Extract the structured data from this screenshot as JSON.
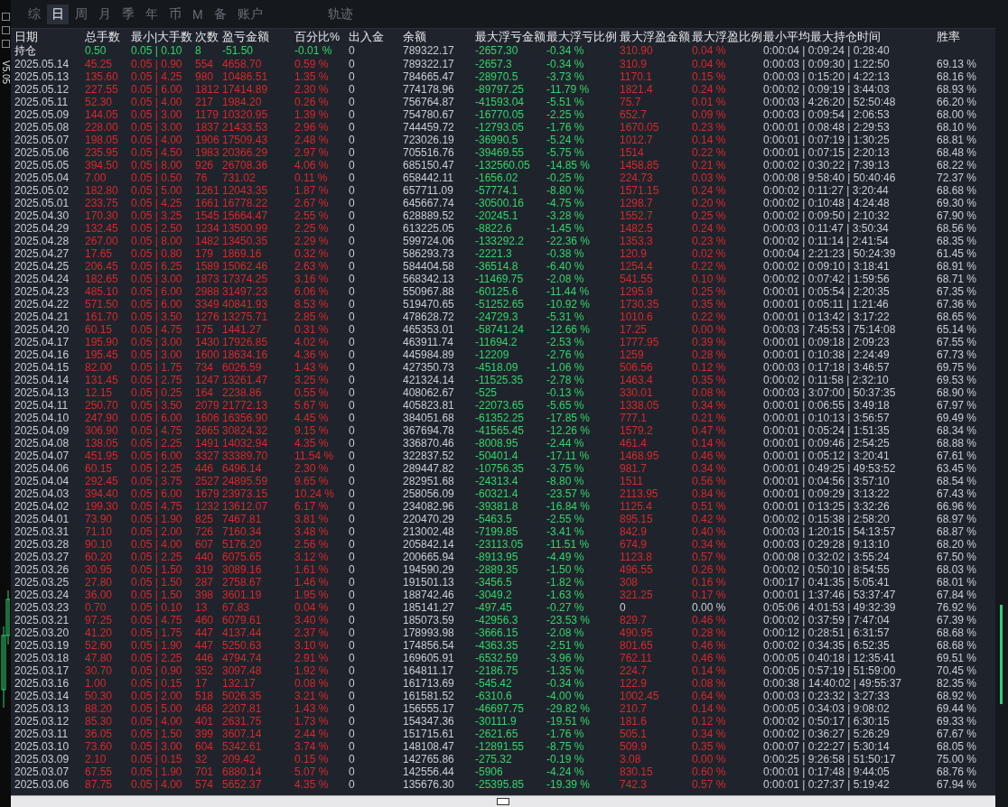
{
  "sidebar": {
    "version": "V5.05"
  },
  "tabs": [
    {
      "label": "综",
      "selected": false
    },
    {
      "label": "日",
      "selected": true
    },
    {
      "label": "周",
      "selected": false
    },
    {
      "label": "月",
      "selected": false
    },
    {
      "label": "季",
      "selected": false
    },
    {
      "label": "年",
      "selected": false
    },
    {
      "label": "币",
      "selected": false
    },
    {
      "label": "M",
      "selected": false
    },
    {
      "label": "备",
      "selected": false
    },
    {
      "label": "账户",
      "selected": false
    }
  ],
  "track_button": {
    "label": "轨迹"
  },
  "table": {
    "columns": [
      "日期",
      "总手数",
      "最小|大手数",
      "次数",
      "盈亏金额",
      "百分比%",
      "出入金",
      "余额",
      "最大浮亏金额",
      "最大浮亏比例",
      "最大浮盈金额",
      "最大浮盈比例",
      "最小平均最大持仓时间",
      "胜率"
    ],
    "holding": {
      "loss": true,
      "zero_peak": false,
      "cells": [
        "持仓",
        "0.50",
        "0.05 | 0.10",
        "8",
        "-51.50",
        "-0.01 %",
        "0",
        "789322.17",
        "-2657.30",
        "-0.34 %",
        "310.90",
        "0.04 %",
        "0:00:04 | 0:09:24 | 0:28:40"
      ]
    },
    "rows": [
      {
        "loss": false,
        "zero_peak": false,
        "cells": [
          "2025.05.14",
          "45.25",
          "0.05 | 0.90",
          "554",
          "4658.70",
          "0.59 %",
          "0",
          "789322.17",
          "-2657.3",
          "-0.34 %",
          "310.9",
          "0.04 %",
          "0:00:03 | 0:09:30 | 1:22:50",
          "69.13 %"
        ]
      },
      {
        "loss": false,
        "zero_peak": false,
        "cells": [
          "2025.05.13",
          "135.60",
          "0.05 | 4.25",
          "980",
          "10486.51",
          "1.35 %",
          "0",
          "784665.47",
          "-28970.5",
          "-3.73 %",
          "1170.1",
          "0.15 %",
          "0:00:03 | 0:15:20 | 4:22:13",
          "68.16 %"
        ]
      },
      {
        "loss": false,
        "zero_peak": false,
        "cells": [
          "2025.05.12",
          "227.55",
          "0.05 | 6.00",
          "1812",
          "17414.89",
          "2.30 %",
          "0",
          "774178.96",
          "-89797.25",
          "-11.79 %",
          "1821.4",
          "0.24 %",
          "0:00:02 | 0:09:19 | 3:44:03",
          "68.93 %"
        ]
      },
      {
        "loss": false,
        "zero_peak": false,
        "cells": [
          "2025.05.11",
          "52.30",
          "0.05 | 4.00",
          "217",
          "1984.20",
          "0.26 %",
          "0",
          "756764.87",
          "-41593.04",
          "-5.51 %",
          "75.7",
          "0.01 %",
          "0:00:03 | 4:26:20 | 52:50:48",
          "66.20 %"
        ]
      },
      {
        "loss": false,
        "zero_peak": false,
        "cells": [
          "2025.05.09",
          "144.05",
          "0.05 | 3.00",
          "1179",
          "10320.95",
          "1.39 %",
          "0",
          "754780.67",
          "-16770.05",
          "-2.25 %",
          "652.7",
          "0.09 %",
          "0:00:03 | 0:09:54 | 2:06:53",
          "68.00 %"
        ]
      },
      {
        "loss": false,
        "zero_peak": false,
        "cells": [
          "2025.05.08",
          "228.00",
          "0.05 | 3.00",
          "1837",
          "21433.53",
          "2.96 %",
          "0",
          "744459.72",
          "-12793.05",
          "-1.76 %",
          "1670.05",
          "0.23 %",
          "0:00:01 | 0:08:48 | 2:29:53",
          "68.10 %"
        ]
      },
      {
        "loss": false,
        "zero_peak": false,
        "cells": [
          "2025.05.07",
          "198.05",
          "0.05 | 4.00",
          "1906",
          "17509.43",
          "2.48 %",
          "0",
          "723026.19",
          "-36990.5",
          "-5.24 %",
          "1012.7",
          "0.14 %",
          "0:00:01 | 0:07:19 | 1:30:25",
          "68.81 %"
        ]
      },
      {
        "loss": false,
        "zero_peak": false,
        "cells": [
          "2025.05.06",
          "235.95",
          "0.05 | 4.50",
          "1983",
          "20366.29",
          "2.97 %",
          "0",
          "705516.76",
          "-39469.55",
          "-5.75 %",
          "1514",
          "0.22 %",
          "0:00:01 | 0:07:15 | 2:20:13",
          "68.48 %"
        ]
      },
      {
        "loss": false,
        "zero_peak": false,
        "cells": [
          "2025.05.05",
          "394.50",
          "0.05 | 8.00",
          "926",
          "26708.36",
          "4.06 %",
          "0",
          "685150.47",
          "-132560.05",
          "-14.85 %",
          "1458.85",
          "0.21 %",
          "0:00:02 | 0:30:22 | 7:39:13",
          "68.22 %"
        ]
      },
      {
        "loss": false,
        "zero_peak": false,
        "cells": [
          "2025.05.04",
          "7.00",
          "0.05 | 0.50",
          "76",
          "731.02",
          "0.11 %",
          "0",
          "658442.11",
          "-1656.02",
          "-0.25 %",
          "224.73",
          "0.03 %",
          "0:00:08 | 9:58:40 | 50:40:46",
          "72.37 %"
        ]
      },
      {
        "loss": false,
        "zero_peak": false,
        "cells": [
          "2025.05.02",
          "182.80",
          "0.05 | 5.00",
          "1261",
          "12043.35",
          "1.87 %",
          "0",
          "657711.09",
          "-57774.1",
          "-8.80 %",
          "1571.15",
          "0.24 %",
          "0:00:02 | 0:11:27 | 3:20:44",
          "68.68 %"
        ]
      },
      {
        "loss": false,
        "zero_peak": false,
        "cells": [
          "2025.05.01",
          "233.75",
          "0.05 | 4.25",
          "1661",
          "16778.22",
          "2.67 %",
          "0",
          "645667.74",
          "-30500.16",
          "-4.75 %",
          "1298.7",
          "0.20 %",
          "0:00:02 | 0:10:48 | 4:24:48",
          "69.30 %"
        ]
      },
      {
        "loss": false,
        "zero_peak": false,
        "cells": [
          "2025.04.30",
          "170.30",
          "0.05 | 3.25",
          "1545",
          "15664.47",
          "2.55 %",
          "0",
          "628889.52",
          "-20245.1",
          "-3.28 %",
          "1552.7",
          "0.25 %",
          "0:00:02 | 0:09:50 | 2:10:32",
          "67.90 %"
        ]
      },
      {
        "loss": false,
        "zero_peak": false,
        "cells": [
          "2025.04.29",
          "132.45",
          "0.05 | 2.50",
          "1234",
          "13500.99",
          "2.25 %",
          "0",
          "613225.05",
          "-8822.6",
          "-1.45 %",
          "1482.5",
          "0.24 %",
          "0:00:03 | 0:11:47 | 3:50:34",
          "68.56 %"
        ]
      },
      {
        "loss": false,
        "zero_peak": false,
        "cells": [
          "2025.04.28",
          "267.00",
          "0.05 | 8.00",
          "1482",
          "13450.35",
          "2.29 %",
          "0",
          "599724.06",
          "-133292.2",
          "-22.36 %",
          "1353.3",
          "0.23 %",
          "0:00:02 | 0:11:14 | 2:41:54",
          "68.35 %"
        ]
      },
      {
        "loss": false,
        "zero_peak": false,
        "cells": [
          "2025.04.27",
          "17.65",
          "0.05 | 0.80",
          "179",
          "1869.16",
          "0.32 %",
          "0",
          "586293.73",
          "-2221.3",
          "-0.38 %",
          "120.9",
          "0.02 %",
          "0:00:04 | 2:21:23 | 50:24:39",
          "61.45 %"
        ]
      },
      {
        "loss": false,
        "zero_peak": false,
        "cells": [
          "2025.04.25",
          "206.45",
          "0.05 | 6.25",
          "1589",
          "15062.46",
          "2.63 %",
          "0",
          "584404.58",
          "-36514.8",
          "-6.40 %",
          "1254.4",
          "0.22 %",
          "0:00:02 | 0:09:10 | 3:18:41",
          "68.91 %"
        ]
      },
      {
        "loss": false,
        "zero_peak": false,
        "cells": [
          "2025.04.24",
          "182.65",
          "0.05 | 3.00",
          "1873",
          "17374.25",
          "3.16 %",
          "0",
          "568342.13",
          "-11469.75",
          "-2.08 %",
          "541.55",
          "0.10 %",
          "0:00:02 | 0:07:42 | 1:59:56",
          "68.71 %"
        ]
      },
      {
        "loss": false,
        "zero_peak": false,
        "cells": [
          "2025.04.23",
          "485.10",
          "0.05 | 6.00",
          "2988",
          "31497.23",
          "6.06 %",
          "0",
          "550967.88",
          "-60125.6",
          "-11.44 %",
          "1295.9",
          "0.25 %",
          "0:00:01 | 0:05:54 | 2:20:35",
          "67.35 %"
        ]
      },
      {
        "loss": false,
        "zero_peak": false,
        "cells": [
          "2025.04.22",
          "571.50",
          "0.05 | 6.00",
          "3349",
          "40841.93",
          "8.53 %",
          "0",
          "519470.65",
          "-51252.65",
          "-10.92 %",
          "1730.35",
          "0.35 %",
          "0:00:01 | 0:05:11 | 1:21:46",
          "67.36 %"
        ]
      },
      {
        "loss": false,
        "zero_peak": false,
        "cells": [
          "2025.04.21",
          "161.70",
          "0.05 | 3.50",
          "1276",
          "13275.71",
          "2.85 %",
          "0",
          "478628.72",
          "-24729.3",
          "-5.31 %",
          "1010.6",
          "0.22 %",
          "0:00:01 | 0:13:42 | 3:17:22",
          "68.65 %"
        ]
      },
      {
        "loss": false,
        "zero_peak": false,
        "cells": [
          "2025.04.20",
          "60.15",
          "0.05 | 4.75",
          "175",
          "1441.27",
          "0.31 %",
          "0",
          "465353.01",
          "-58741.24",
          "-12.66 %",
          "17.25",
          "0.00 %",
          "0:00:03 | 7:45:53 | 75:14:08",
          "65.14 %"
        ]
      },
      {
        "loss": false,
        "zero_peak": false,
        "cells": [
          "2025.04.17",
          "195.90",
          "0.05 | 3.00",
          "1430",
          "17926.85",
          "4.02 %",
          "0",
          "463911.74",
          "-11694.2",
          "-2.53 %",
          "1777.95",
          "0.39 %",
          "0:00:01 | 0:09:18 | 2:09:23",
          "67.55 %"
        ]
      },
      {
        "loss": false,
        "zero_peak": false,
        "cells": [
          "2025.04.16",
          "195.45",
          "0.05 | 3.00",
          "1600",
          "18634.16",
          "4.36 %",
          "0",
          "445984.89",
          "-12209",
          "-2.76 %",
          "1259",
          "0.28 %",
          "0:00:01 | 0:10:38 | 2:24:49",
          "67.73 %"
        ]
      },
      {
        "loss": false,
        "zero_peak": false,
        "cells": [
          "2025.04.15",
          "82.00",
          "0.05 | 1.75",
          "734",
          "6026.59",
          "1.43 %",
          "0",
          "427350.73",
          "-4518.09",
          "-1.06 %",
          "506.56",
          "0.12 %",
          "0:00:03 | 0:17:18 | 3:46:57",
          "69.75 %"
        ]
      },
      {
        "loss": false,
        "zero_peak": false,
        "cells": [
          "2025.04.14",
          "131.45",
          "0.05 | 2.75",
          "1247",
          "13261.47",
          "3.25 %",
          "0",
          "421324.14",
          "-11525.35",
          "-2.78 %",
          "1463.4",
          "0.35 %",
          "0:00:02 | 0:11:58 | 2:32:10",
          "69.53 %"
        ]
      },
      {
        "loss": false,
        "zero_peak": false,
        "cells": [
          "2025.04.13",
          "12.15",
          "0.05 | 0.25",
          "164",
          "2238.86",
          "0.55 %",
          "0",
          "408062.67",
          "-525",
          "-0.13 %",
          "330.01",
          "0.08 %",
          "0:00:03 | 3:07:00 | 50:37:35",
          "68.90 %"
        ]
      },
      {
        "loss": false,
        "zero_peak": false,
        "cells": [
          "2025.04.11",
          "250.70",
          "0.05 | 3.50",
          "2079",
          "21772.13",
          "5.67 %",
          "0",
          "405823.81",
          "-22073.65",
          "-5.65 %",
          "1338.05",
          "0.34 %",
          "0:00:01 | 0:06:55 | 3:49:18",
          "67.97 %"
        ]
      },
      {
        "loss": false,
        "zero_peak": false,
        "cells": [
          "2025.04.10",
          "247.90",
          "0.05 | 6.00",
          "1606",
          "16356.90",
          "4.45 %",
          "0",
          "384051.68",
          "-61352.25",
          "-17.85 %",
          "777.1",
          "0.21 %",
          "0:00:01 | 0:10:13 | 3:56:57",
          "69.49 %"
        ]
      },
      {
        "loss": false,
        "zero_peak": false,
        "cells": [
          "2025.04.09",
          "306.90",
          "0.05 | 4.75",
          "2665",
          "30824.32",
          "9.15 %",
          "0",
          "367694.78",
          "-41565.45",
          "-12.26 %",
          "1579.2",
          "0.47 %",
          "0:00:01 | 0:05:24 | 1:51:35",
          "68.34 %"
        ]
      },
      {
        "loss": false,
        "zero_peak": false,
        "cells": [
          "2025.04.08",
          "138.05",
          "0.05 | 2.25",
          "1491",
          "14032.94",
          "4.35 %",
          "0",
          "336870.46",
          "-8008.95",
          "-2.44 %",
          "461.4",
          "0.14 %",
          "0:00:01 | 0:09:46 | 2:54:25",
          "68.88 %"
        ]
      },
      {
        "loss": false,
        "zero_peak": false,
        "cells": [
          "2025.04.07",
          "451.95",
          "0.05 | 6.00",
          "3327",
          "33389.70",
          "11.54 %",
          "0",
          "322837.52",
          "-50401.4",
          "-17.11 %",
          "1468.95",
          "0.46 %",
          "0:00:01 | 0:05:12 | 3:20:41",
          "67.61 %"
        ]
      },
      {
        "loss": false,
        "zero_peak": false,
        "cells": [
          "2025.04.06",
          "60.15",
          "0.05 | 2.25",
          "446",
          "6496.14",
          "2.30 %",
          "0",
          "289447.82",
          "-10756.35",
          "-3.75 %",
          "981.7",
          "0.34 %",
          "0:00:01 | 0:49:25 | 49:53:52",
          "63.45 %"
        ]
      },
      {
        "loss": false,
        "zero_peak": false,
        "cells": [
          "2025.04.04",
          "292.45",
          "0.05 | 3.75",
          "2527",
          "24895.59",
          "9.65 %",
          "0",
          "282951.68",
          "-24313.4",
          "-8.80 %",
          "1511",
          "0.56 %",
          "0:00:01 | 0:04:56 | 3:57:10",
          "68.54 %"
        ]
      },
      {
        "loss": false,
        "zero_peak": false,
        "cells": [
          "2025.04.03",
          "394.40",
          "0.05 | 6.00",
          "1679",
          "23973.15",
          "10.24 %",
          "0",
          "258056.09",
          "-60321.4",
          "-23.57 %",
          "2113.95",
          "0.84 %",
          "0:00:01 | 0:09:29 | 3:13:22",
          "67.43 %"
        ]
      },
      {
        "loss": false,
        "zero_peak": false,
        "cells": [
          "2025.04.02",
          "199.30",
          "0.05 | 4.75",
          "1232",
          "13612.07",
          "6.17 %",
          "0",
          "234082.96",
          "-39381.8",
          "-16.84 %",
          "1125.4",
          "0.51 %",
          "0:00:01 | 0:13:25 | 3:32:26",
          "66.96 %"
        ]
      },
      {
        "loss": false,
        "zero_peak": false,
        "cells": [
          "2025.04.01",
          "73.90",
          "0.05 | 1.90",
          "825",
          "7467.81",
          "3.81 %",
          "0",
          "220470.29",
          "-5463.5",
          "-2.55 %",
          "895.15",
          "0.42 %",
          "0:00:02 | 0:15:38 | 2:58:20",
          "68.97 %"
        ]
      },
      {
        "loss": false,
        "zero_peak": false,
        "cells": [
          "2025.03.31",
          "71.10",
          "0.05 | 2.00",
          "726",
          "7160.34",
          "3.48 %",
          "0",
          "213002.48",
          "-7199.85",
          "-3.41 %",
          "842.9",
          "0.40 %",
          "0:00:03 | 1:20:15 | 54:13:57",
          "68.87 %"
        ]
      },
      {
        "loss": false,
        "zero_peak": false,
        "cells": [
          "2025.03.28",
          "90.10",
          "0.05 | 4.00",
          "607",
          "5176.20",
          "2.56 %",
          "0",
          "205842.14",
          "-23113.05",
          "-11.51 %",
          "674.9",
          "0.34 %",
          "0:00:03 | 0:29:28 | 9:13:10",
          "68.20 %"
        ]
      },
      {
        "loss": false,
        "zero_peak": false,
        "cells": [
          "2025.03.27",
          "60.20",
          "0.05 | 2.25",
          "440",
          "6075.65",
          "3.12 %",
          "0",
          "200665.94",
          "-8913.95",
          "-4.49 %",
          "1123.8",
          "0.57 %",
          "0:00:08 | 0:32:02 | 3:55:24",
          "67.50 %"
        ]
      },
      {
        "loss": false,
        "zero_peak": false,
        "cells": [
          "2025.03.26",
          "30.95",
          "0.05 | 1.50",
          "319",
          "3089.16",
          "1.61 %",
          "0",
          "194590.29",
          "-2889.35",
          "-1.50 %",
          "496.55",
          "0.26 %",
          "0:00:02 | 0:50:10 | 8:54:55",
          "68.03 %"
        ]
      },
      {
        "loss": false,
        "zero_peak": false,
        "cells": [
          "2025.03.25",
          "27.80",
          "0.05 | 1.50",
          "287",
          "2758.67",
          "1.46 %",
          "0",
          "191501.13",
          "-3456.5",
          "-1.82 %",
          "308",
          "0.16 %",
          "0:00:17 | 0:41:35 | 5:05:41",
          "68.01 %"
        ]
      },
      {
        "loss": false,
        "zero_peak": false,
        "cells": [
          "2025.03.24",
          "36.00",
          "0.05 | 1.50",
          "398",
          "3601.19",
          "1.95 %",
          "0",
          "188742.46",
          "-3049.2",
          "-1.63 %",
          "321.25",
          "0.17 %",
          "0:00:01 | 1:37:46 | 53:37:47",
          "67.84 %"
        ]
      },
      {
        "loss": false,
        "zero_peak": true,
        "cells": [
          "2025.03.23",
          "0.70",
          "0.05 | 0.10",
          "13",
          "67.83",
          "0.04 %",
          "0",
          "185141.27",
          "-497.45",
          "-0.27 %",
          "0",
          "0.00 %",
          "0:05:06 | 4:01:53 | 49:32:39",
          "76.92 %"
        ]
      },
      {
        "loss": false,
        "zero_peak": false,
        "cells": [
          "2025.03.21",
          "97.25",
          "0.05 | 4.75",
          "460",
          "6079.61",
          "3.40 %",
          "0",
          "185073.59",
          "-42956.3",
          "-23.53 %",
          "829.7",
          "0.46 %",
          "0:00:02 | 0:37:59 | 7:47:04",
          "67.39 %"
        ]
      },
      {
        "loss": false,
        "zero_peak": false,
        "cells": [
          "2025.03.20",
          "41.20",
          "0.05 | 1.75",
          "447",
          "4137.44",
          "2.37 %",
          "0",
          "178993.98",
          "-3666.15",
          "-2.08 %",
          "490.95",
          "0.28 %",
          "0:00:12 | 0:28:51 | 6:31:57",
          "68.68 %"
        ]
      },
      {
        "loss": false,
        "zero_peak": false,
        "cells": [
          "2025.03.19",
          "52.60",
          "0.05 | 1.90",
          "447",
          "5250.63",
          "3.10 %",
          "0",
          "174856.54",
          "-4363.35",
          "-2.51 %",
          "801.65",
          "0.46 %",
          "0:00:02 | 0:34:35 | 6:52:35",
          "68.68 %"
        ]
      },
      {
        "loss": false,
        "zero_peak": false,
        "cells": [
          "2025.03.18",
          "47.80",
          "0.05 | 2.25",
          "446",
          "4794.74",
          "2.91 %",
          "0",
          "169605.91",
          "-6532.59",
          "-3.96 %",
          "762.11",
          "0.46 %",
          "0:00:05 | 0:40:18 | 12:35:41",
          "69.51 %"
        ]
      },
      {
        "loss": false,
        "zero_peak": false,
        "cells": [
          "2025.03.17",
          "30.70",
          "0.05 | 0.90",
          "352",
          "3097.48",
          "1.92 %",
          "0",
          "164811.17",
          "-2186.75",
          "-1.35 %",
          "224.7",
          "0.14 %",
          "0:00:05 | 0:57:19 | 51:59:00",
          "70.45 %"
        ]
      },
      {
        "loss": false,
        "zero_peak": false,
        "cells": [
          "2025.03.16",
          "1.00",
          "0.05 | 0.15",
          "17",
          "132.17",
          "0.08 %",
          "0",
          "161713.69",
          "-545.42",
          "-0.34 %",
          "122.9",
          "0.08 %",
          "0:00:38 | 14:40:02 | 49:55:37",
          "82.35 %"
        ]
      },
      {
        "loss": false,
        "zero_peak": false,
        "cells": [
          "2025.03.14",
          "50.30",
          "0.05 | 2.00",
          "518",
          "5026.35",
          "3.21 %",
          "0",
          "161581.52",
          "-6310.6",
          "-4.00 %",
          "1002.45",
          "0.64 %",
          "0:00:03 | 0:23:32 | 3:27:33",
          "68.92 %"
        ]
      },
      {
        "loss": false,
        "zero_peak": false,
        "cells": [
          "2025.03.13",
          "88.20",
          "0.05 | 5.00",
          "468",
          "2207.81",
          "1.43 %",
          "0",
          "156555.17",
          "-46697.75",
          "-29.82 %",
          "210.7",
          "0.14 %",
          "0:00:05 | 0:34:03 | 9:08:02",
          "69.44 %"
        ]
      },
      {
        "loss": false,
        "zero_peak": false,
        "cells": [
          "2025.03.12",
          "85.30",
          "0.05 | 4.00",
          "401",
          "2631.75",
          "1.73 %",
          "0",
          "154347.36",
          "-30111.9",
          "-19.51 %",
          "181.6",
          "0.12 %",
          "0:00:02 | 0:50:17 | 6:30:15",
          "69.33 %"
        ]
      },
      {
        "loss": false,
        "zero_peak": false,
        "cells": [
          "2025.03.11",
          "36.05",
          "0.05 | 1.50",
          "399",
          "3607.14",
          "2.44 %",
          "0",
          "151715.61",
          "-2621.65",
          "-1.76 %",
          "505.1",
          "0.34 %",
          "0:00:02 | 0:36:27 | 5:26:29",
          "67.67 %"
        ]
      },
      {
        "loss": false,
        "zero_peak": false,
        "cells": [
          "2025.03.10",
          "73.60",
          "0.05 | 3.00",
          "604",
          "5342.61",
          "3.74 %",
          "0",
          "148108.47",
          "-12891.55",
          "-8.75 %",
          "509.9",
          "0.35 %",
          "0:00:07 | 0:22:27 | 5:30:14",
          "68.05 %"
        ]
      },
      {
        "loss": false,
        "zero_peak": false,
        "cells": [
          "2025.03.09",
          "2.10",
          "0.05 | 0.15",
          "32",
          "209.42",
          "0.15 %",
          "0",
          "142765.86",
          "-275.32",
          "-0.19 %",
          "3.08",
          "0.00 %",
          "0:00:25 | 9:26:58 | 51:50:17",
          "75.00 %"
        ]
      },
      {
        "loss": false,
        "zero_peak": false,
        "cells": [
          "2025.03.07",
          "67.55",
          "0.05 | 1.90",
          "701",
          "6880.14",
          "5.07 %",
          "0",
          "142556.44",
          "-5906",
          "-4.24 %",
          "830.15",
          "0.60 %",
          "0:00:01 | 0:17:48 | 9:44:05",
          "68.76 %"
        ]
      },
      {
        "loss": false,
        "zero_peak": false,
        "cells": [
          "2025.03.06",
          "87.75",
          "0.05 | 4.00",
          "574",
          "5652.37",
          "4.35 %",
          "0",
          "135676.30",
          "-25395.85",
          "-19.39 %",
          "742.3",
          "0.57 %",
          "0:00:01 | 0:27:37 | 5:19:42",
          "67.94 %"
        ]
      }
    ]
  }
}
